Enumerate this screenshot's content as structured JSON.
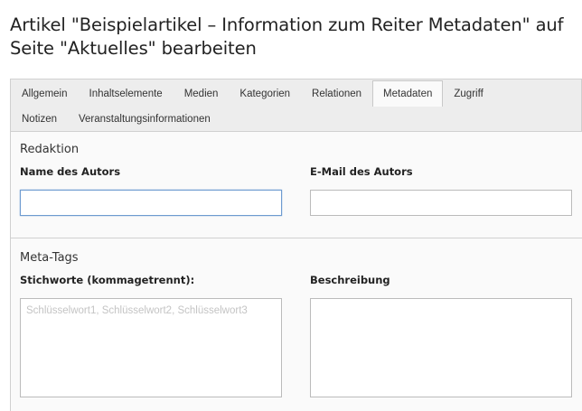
{
  "page": {
    "title": "Artikel \"Beispielartikel – Information zum Reiter Metadaten\" auf Seite \"Aktuelles\" bearbeiten"
  },
  "tabs": {
    "row1": [
      {
        "label": "Allgemein",
        "active": false
      },
      {
        "label": "Inhaltselemente",
        "active": false
      },
      {
        "label": "Medien",
        "active": false
      },
      {
        "label": "Kategorien",
        "active": false
      },
      {
        "label": "Relationen",
        "active": false
      },
      {
        "label": "Metadaten",
        "active": true
      },
      {
        "label": "Zugriff",
        "active": false
      }
    ],
    "row2": [
      {
        "label": "Notizen",
        "active": false
      },
      {
        "label": "Veranstaltungsinformationen",
        "active": false
      }
    ]
  },
  "sections": {
    "redaktion": {
      "title": "Redaktion",
      "author_name": {
        "label": "Name des Autors",
        "value": ""
      },
      "author_email": {
        "label": "E-Mail des Autors",
        "value": ""
      }
    },
    "meta_tags": {
      "title": "Meta-Tags",
      "keywords": {
        "label": "Stichworte (kommagetrennt):",
        "placeholder": "Schlüsselwort1, Schlüsselwort2, Schlüsselwort3",
        "value": ""
      },
      "description": {
        "label": "Beschreibung",
        "value": ""
      }
    }
  },
  "colors": {
    "tab_bar_bg": "#ededed",
    "content_bg": "#fafafa",
    "focus_border": "#6e9bd0"
  }
}
